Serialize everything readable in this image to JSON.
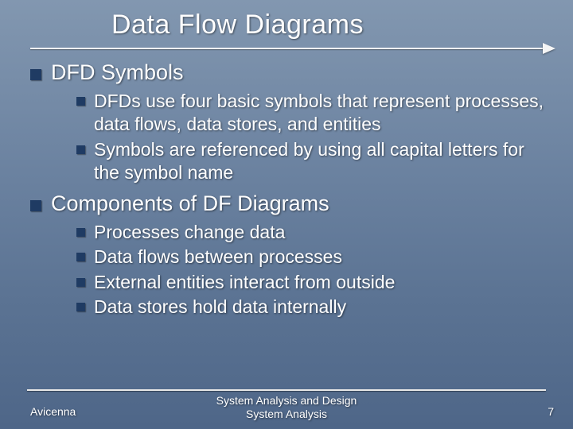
{
  "title": "Data Flow Diagrams",
  "sections": [
    {
      "heading": "DFD Symbols",
      "items": [
        "DFDs use four basic symbols that represent processes, data flows, data stores, and entities",
        "Symbols are referenced by using all capital letters for the symbol name"
      ]
    },
    {
      "heading": "Components of DF Diagrams",
      "items": [
        "Processes change data",
        "Data flows between processes",
        "External entities interact from outside",
        "Data stores hold data internally"
      ]
    }
  ],
  "footer": {
    "left": "Avicenna",
    "center_line1": "System Analysis and Design",
    "center_line2": "System Analysis",
    "page": "7"
  }
}
